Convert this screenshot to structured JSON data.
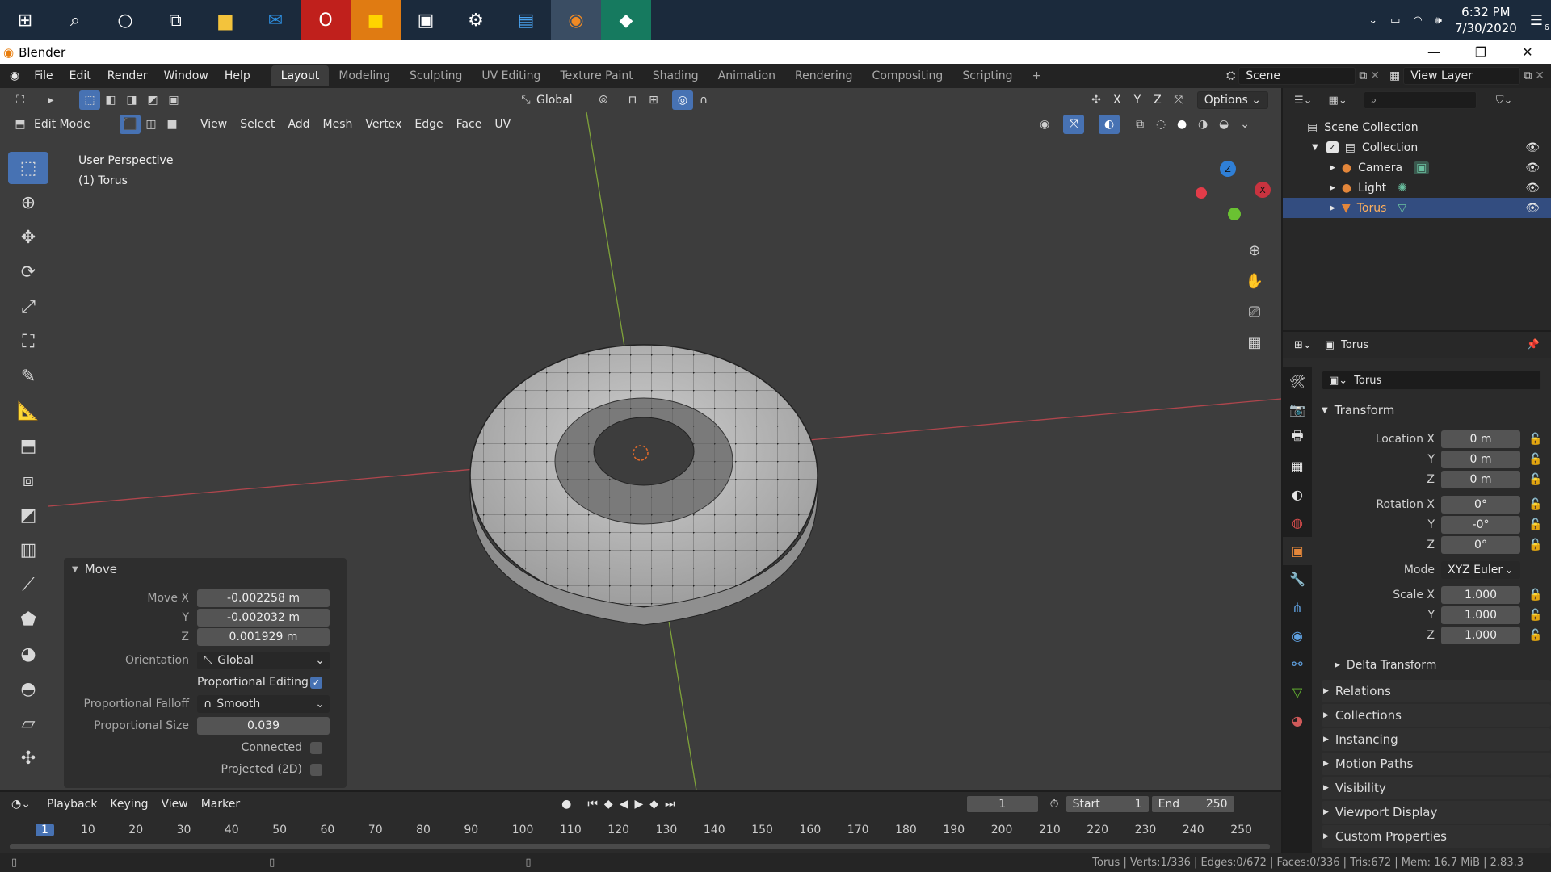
{
  "taskbar": {
    "apps": [
      "start-icon",
      "search-icon",
      "cortana-icon",
      "task-view-icon",
      "file-explorer-icon",
      "mail-icon",
      "opera-icon",
      "sticky-notes-icon",
      "photos-icon",
      "settings-icon",
      "news-icon",
      "blender-icon",
      "app-icon"
    ],
    "time": "6:32 PM",
    "date": "7/30/2020",
    "notification_count": "6"
  },
  "window": {
    "title": "Blender"
  },
  "menu": [
    "File",
    "Edit",
    "Render",
    "Window",
    "Help"
  ],
  "workspaces": [
    "Layout",
    "Modeling",
    "Sculpting",
    "UV Editing",
    "Texture Paint",
    "Shading",
    "Animation",
    "Rendering",
    "Compositing",
    "Scripting"
  ],
  "active_workspace": "Layout",
  "scene": {
    "name": "Scene",
    "view_layer": "View Layer"
  },
  "viewport": {
    "transform_orientation": "Global",
    "options_label": "Options",
    "axes": [
      "X",
      "Y",
      "Z"
    ],
    "mode": "Edit Mode",
    "header_menus": [
      "View",
      "Select",
      "Add",
      "Mesh",
      "Vertex",
      "Edge",
      "Face",
      "UV"
    ],
    "overlay_text_1": "User Perspective",
    "overlay_text_2": "(1) Torus",
    "gizmo_labels": [
      "Z",
      "X"
    ]
  },
  "operator_panel": {
    "title": "Move",
    "move_x_label": "Move X",
    "move_x": "-0.002258 m",
    "y_label": "Y",
    "move_y": "-0.002032 m",
    "z_label": "Z",
    "move_z": "0.001929 m",
    "orientation_label": "Orientation",
    "orientation": "Global",
    "prop_edit_label": "Proportional Editing",
    "falloff_label": "Proportional Falloff",
    "falloff": "Smooth",
    "size_label": "Proportional Size",
    "size": "0.039",
    "connected_label": "Connected",
    "projected_label": "Projected (2D)"
  },
  "outliner": {
    "root": "Scene Collection",
    "items": [
      {
        "name": "Collection"
      },
      {
        "name": "Camera"
      },
      {
        "name": "Light"
      },
      {
        "name": "Torus"
      }
    ]
  },
  "properties": {
    "object_name": "Torus",
    "datablock": "Torus",
    "transform_label": "Transform",
    "location_label": "Location X",
    "loc_x": "0 m",
    "loc_y": "0 m",
    "loc_z": "0 m",
    "rotation_label": "Rotation X",
    "rot_x": "0°",
    "rot_y": "-0°",
    "rot_z": "0°",
    "mode_label": "Mode",
    "mode": "XYZ Euler",
    "scale_label": "Scale X",
    "scale_x": "1.000",
    "scale_y": "1.000",
    "scale_z": "1.000",
    "y": "Y",
    "z": "Z",
    "delta_transform": "Delta Transform",
    "sections": [
      "Relations",
      "Collections",
      "Instancing",
      "Motion Paths",
      "Visibility",
      "Viewport Display",
      "Custom Properties"
    ]
  },
  "timeline": {
    "menus": [
      "Playback",
      "Keying",
      "View",
      "Marker"
    ],
    "current_frame": "1",
    "start_label": "Start",
    "start": "1",
    "end_label": "End",
    "end": "250",
    "ruler": [
      "1",
      "10",
      "20",
      "30",
      "40",
      "50",
      "60",
      "70",
      "80",
      "90",
      "100",
      "110",
      "120",
      "130",
      "140",
      "150",
      "160",
      "170",
      "180",
      "190",
      "200",
      "210",
      "220",
      "230",
      "240",
      "250"
    ]
  },
  "status": "Torus | Verts:1/336 | Edges:0/672 | Faces:0/336 | Tris:672 | Mem: 16.7 MiB | 2.83.3"
}
